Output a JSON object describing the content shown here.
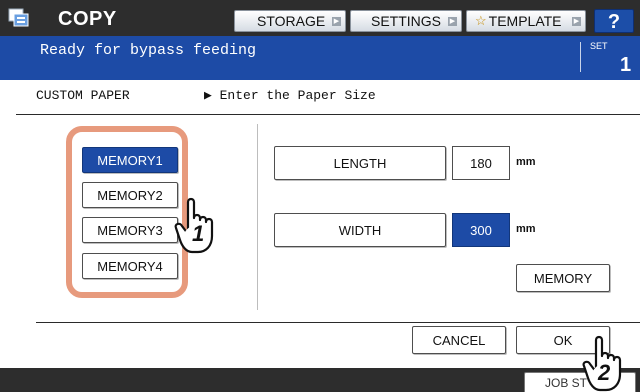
{
  "header": {
    "app_icon": "copy-icon",
    "title": "COPY",
    "buttons": {
      "storage": "STORAGE",
      "settings": "SETTINGS",
      "template": "TEMPLATE"
    },
    "template_icon": "star-icon",
    "help": "?"
  },
  "status": {
    "message": "Ready for bypass feeding",
    "set_label": "SET",
    "set_count": "1"
  },
  "main": {
    "title": "CUSTOM PAPER",
    "hint": "▶ Enter the Paper Size",
    "memories": [
      "MEMORY1",
      "MEMORY2",
      "MEMORY3",
      "MEMORY4"
    ],
    "selected_memory": "MEMORY1",
    "length": {
      "label": "LENGTH",
      "value": "180",
      "unit": "mm"
    },
    "width": {
      "label": "WIDTH",
      "value": "300",
      "unit": "mm",
      "selected": true
    },
    "memory_button": "MEMORY",
    "cancel": "CANCEL",
    "ok": "OK"
  },
  "callouts": [
    "1",
    "2"
  ],
  "footer": {
    "job_status": "JOB ST"
  },
  "colors": {
    "accent": "#1d4ba6",
    "highlight": "#e79a7d",
    "bar": "#2d2d2d"
  }
}
